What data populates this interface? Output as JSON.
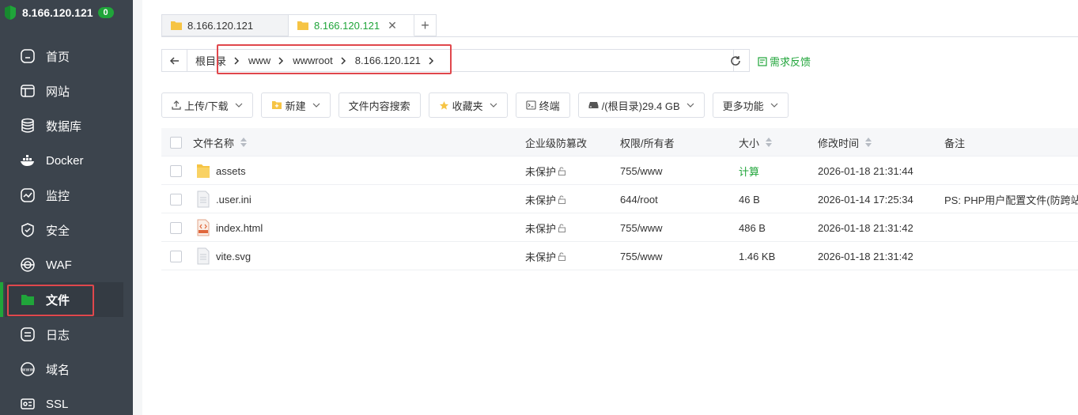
{
  "brand": {
    "ip": "8.166.120.121",
    "badge": "0"
  },
  "sidebar": {
    "items": [
      {
        "label": "首页",
        "icon": "home-icon"
      },
      {
        "label": "网站",
        "icon": "website-icon"
      },
      {
        "label": "数据库",
        "icon": "database-icon"
      },
      {
        "label": "Docker",
        "icon": "docker-icon"
      },
      {
        "label": "监控",
        "icon": "monitor-icon"
      },
      {
        "label": "安全",
        "icon": "shield-icon"
      },
      {
        "label": "WAF",
        "icon": "waf-icon"
      },
      {
        "label": "文件",
        "icon": "folder-icon",
        "active": true
      },
      {
        "label": "日志",
        "icon": "log-icon"
      },
      {
        "label": "域名",
        "icon": "www-icon"
      },
      {
        "label": "SSL",
        "icon": "ssl-icon"
      }
    ]
  },
  "tabs": [
    {
      "label": "8.166.120.121",
      "active": false
    },
    {
      "label": "8.166.120.121",
      "active": true
    }
  ],
  "path": {
    "root": "根目录",
    "segments": [
      "www",
      "wwwroot",
      "8.166.120.121"
    ]
  },
  "feedback": "需求反馈",
  "toolbar": {
    "upload": "上传/下载",
    "new": "新建",
    "search_content": "文件内容搜索",
    "favorites": "收藏夹",
    "terminal": "终端",
    "disk": "/(根目录)29.4 GB",
    "more": "更多功能"
  },
  "table": {
    "headers": {
      "name": "文件名称",
      "tamper": "企业级防篡改",
      "perm": "权限/所有者",
      "size": "大小",
      "mtime": "修改时间",
      "note": "备注"
    },
    "rows": [
      {
        "name": "assets",
        "type": "folder",
        "tamper": "未保护",
        "perm": "755/www",
        "size": "计算",
        "mtime": "2026-01-18 21:31:44",
        "note": ""
      },
      {
        "name": ".user.ini",
        "type": "file",
        "tamper": "未保护",
        "perm": "644/root",
        "size": "46 B",
        "mtime": "2026-01-14 17:25:34",
        "note": "PS: PHP用户配置文件(防跨站)!"
      },
      {
        "name": "index.html",
        "type": "html",
        "tamper": "未保护",
        "perm": "755/www",
        "size": "486 B",
        "mtime": "2026-01-18 21:31:42",
        "note": ""
      },
      {
        "name": "vite.svg",
        "type": "file",
        "tamper": "未保护",
        "perm": "755/www",
        "size": "1.46 KB",
        "mtime": "2026-01-18 21:31:42",
        "note": ""
      }
    ]
  },
  "colors": {
    "accent": "#20a53a",
    "sidebar_bg": "#3c444d",
    "highlight": "#e0474c"
  }
}
